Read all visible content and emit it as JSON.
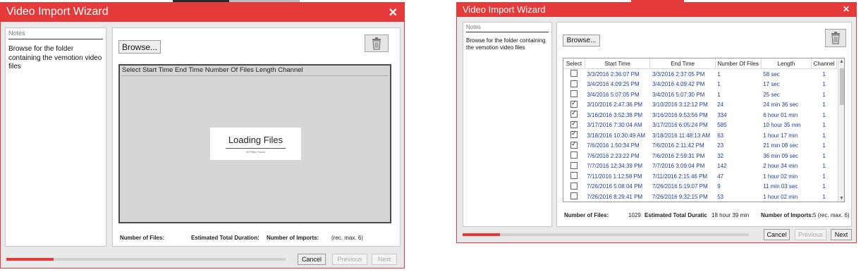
{
  "left_dialog": {
    "title": "Video Import Wizard",
    "notes": {
      "title": "Notes",
      "text": "Browse for the folder containing the vemotion video files"
    },
    "browse_label": "Browse...",
    "list_header": "Select Start Time End Time Number Of Files Length Channel",
    "loading": {
      "title": "Loading Files",
      "subtitle": "50 Files Found"
    },
    "footer": {
      "files_label": "Number of Files:",
      "duration_label": "Estimated Total Duration:",
      "imports_label": "Number of Imports:",
      "imports_suffix": "(rec. max. 6)"
    },
    "progress": 0.17,
    "buttons": {
      "cancel": "Cancel",
      "previous": "Previous",
      "next": "Next"
    }
  },
  "right_dialog": {
    "title": "Video Import Wizard",
    "notes": {
      "title": "Notes",
      "text": "Browse for the folder containing the vemotion video files"
    },
    "browse_label": "Browse...",
    "columns": [
      "Select",
      "Start Time",
      "End Time",
      "Number Of Files",
      "Length",
      "Channel"
    ],
    "rows": [
      {
        "checked": false,
        "start": "3/3/2016 2:36:07 PM",
        "end": "3/3/2016 2:37:05 PM",
        "count": "1",
        "length": "58 sec",
        "channel": "1"
      },
      {
        "checked": false,
        "start": "3/4/2016 4:09:25 PM",
        "end": "3/4/2016 4:09:42 PM",
        "count": "1",
        "length": "17 sec",
        "channel": "1"
      },
      {
        "checked": false,
        "start": "3/4/2016 5:07:05 PM",
        "end": "3/4/2016 5:07:30 PM",
        "count": "1",
        "length": "25 sec",
        "channel": "1"
      },
      {
        "checked": true,
        "start": "3/10/2016 2:47:36 PM",
        "end": "3/10/2016 3:12:12 PM",
        "count": "24",
        "length": "24 min 36 sec",
        "channel": "1"
      },
      {
        "checked": true,
        "start": "3/16/2016 3:52:38 PM",
        "end": "3/16/2016 9:53:56 PM",
        "count": "334",
        "length": "6 hour 01 min",
        "channel": "1"
      },
      {
        "checked": true,
        "start": "3/17/2016 7:30:04 AM",
        "end": "3/17/2016 6:05:24 PM",
        "count": "585",
        "length": "10 hour 35 min",
        "channel": "1"
      },
      {
        "checked": true,
        "start": "3/18/2016 10:30:49 AM",
        "end": "3/18/2016 11:48:13 AM",
        "count": "63",
        "length": "1 hour 17 min",
        "channel": "1"
      },
      {
        "checked": true,
        "start": "7/6/2016 1:50:34 PM",
        "end": "7/6/2016 2:11:42 PM",
        "count": "23",
        "length": "21 min 08 sec",
        "channel": "1"
      },
      {
        "checked": false,
        "start": "7/6/2016 2:23:22 PM",
        "end": "7/6/2016 2:59:31 PM",
        "count": "32",
        "length": "36 min 09 sec",
        "channel": "1"
      },
      {
        "checked": false,
        "start": "7/7/2016 12:34:39 PM",
        "end": "7/7/2016 3:09:04 PM",
        "count": "142",
        "length": "2 hour 34 min",
        "channel": "1"
      },
      {
        "checked": false,
        "start": "7/11/2016 1:12:58 PM",
        "end": "7/11/2016 2:15:46 PM",
        "count": "47",
        "length": "1 hour 02 min",
        "channel": "1"
      },
      {
        "checked": false,
        "start": "7/26/2016 5:08:04 PM",
        "end": "7/26/2016 5:19:07 PM",
        "count": "9",
        "length": "11 min 03 sec",
        "channel": "1"
      },
      {
        "checked": false,
        "start": "7/26/2016 8:29:41 PM",
        "end": "7/26/2016 9:32:15 PM",
        "count": "53",
        "length": "1 hour 02 min",
        "channel": "1"
      }
    ],
    "footer": {
      "files_label": "Number of Files:",
      "files_value": "1029",
      "duration_label": "Estimated Total Duratic",
      "duration_value": "18 hour 39 min",
      "imports_label": "Number of Imports:",
      "imports_value": "5 (rec. max. 6)"
    },
    "progress": 0.13,
    "buttons": {
      "cancel": "Cancel",
      "previous": "Previous",
      "next": "Next"
    }
  },
  "colors": {
    "accent": "#e53a3a",
    "link_text": "#1e3f9c"
  },
  "icons": {
    "close": "close-icon",
    "trash": "trash-icon",
    "checkbox": "checkbox-icon"
  }
}
